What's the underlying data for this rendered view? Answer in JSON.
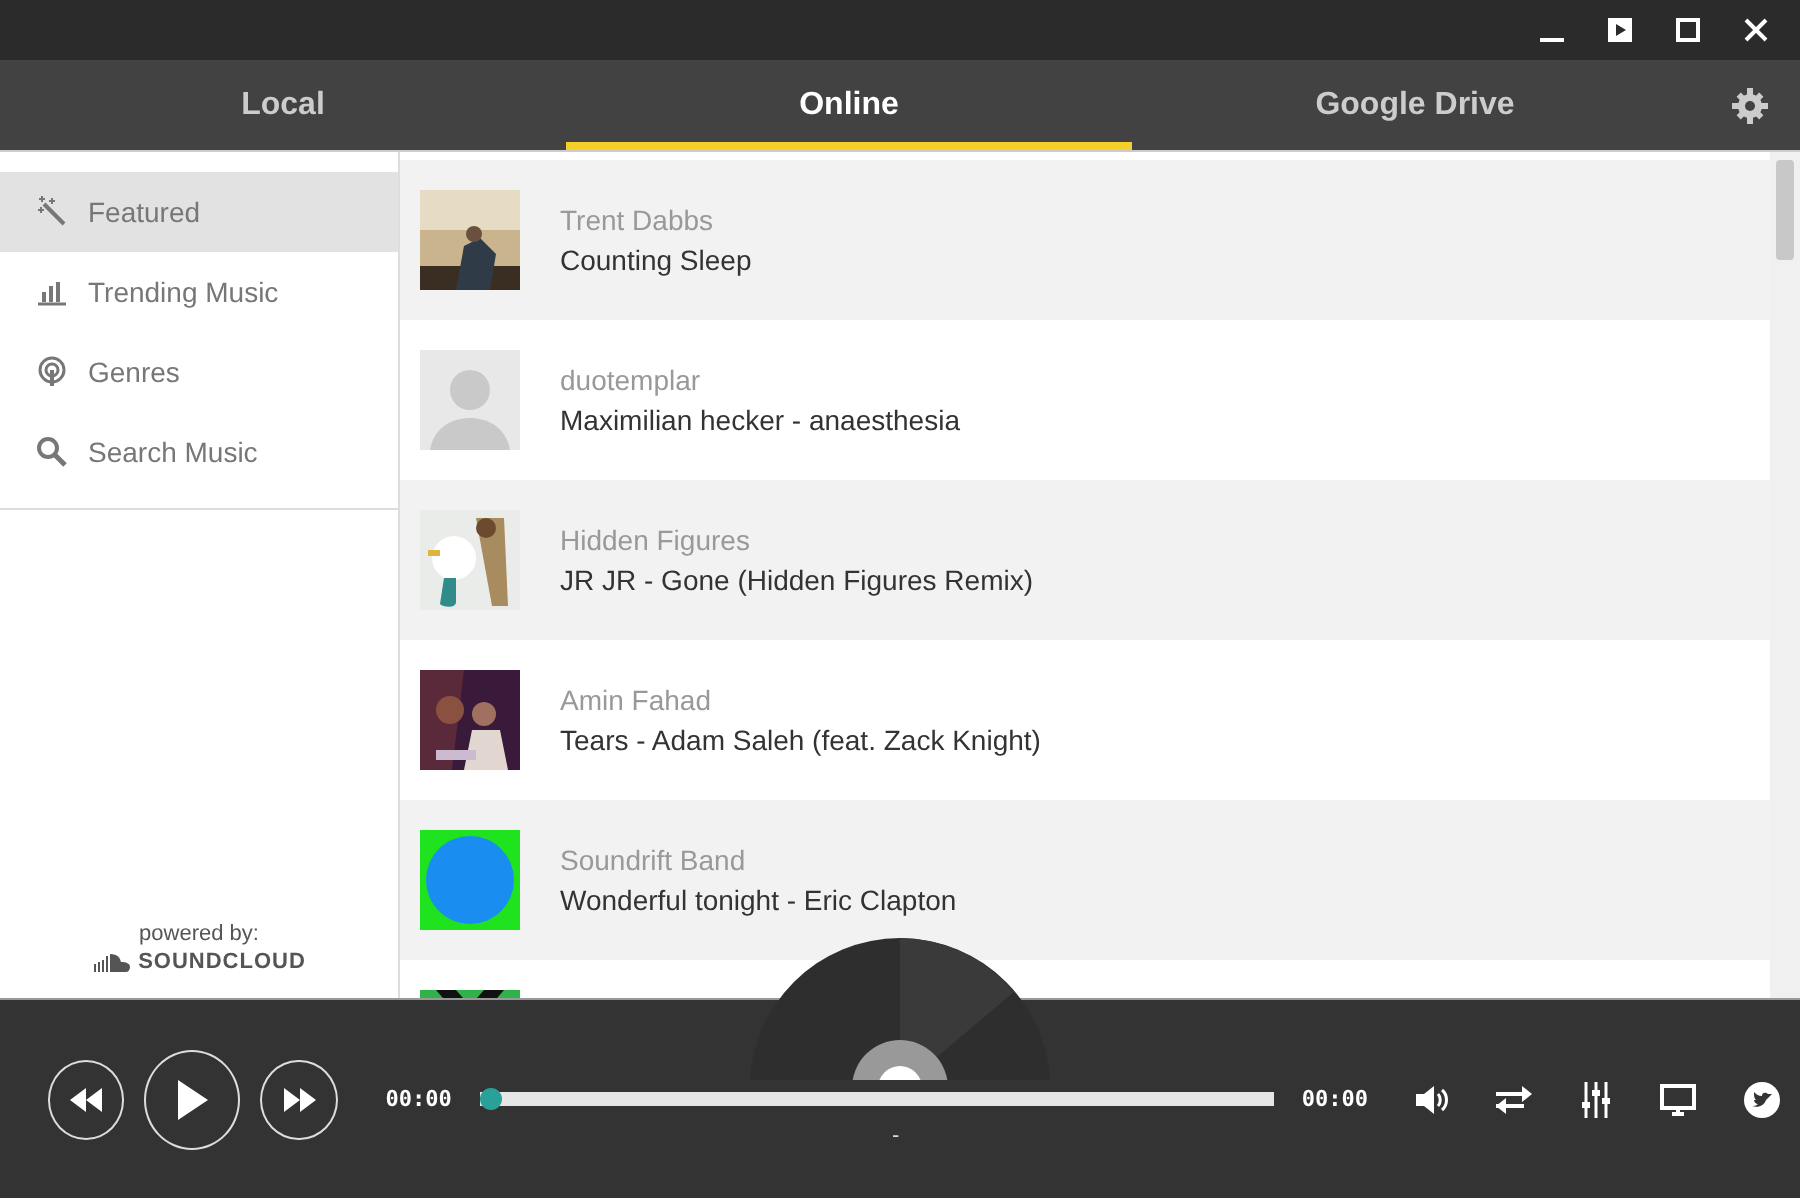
{
  "tabs": [
    {
      "label": "Local",
      "selected": false
    },
    {
      "label": "Online",
      "selected": true
    },
    {
      "label": "Google Drive",
      "selected": false
    }
  ],
  "sidebar": {
    "items": [
      {
        "label": "Featured",
        "selected": true
      },
      {
        "label": "Trending Music",
        "selected": false
      },
      {
        "label": "Genres",
        "selected": false
      },
      {
        "label": "Search Music",
        "selected": false
      }
    ],
    "powered_by": "powered by:",
    "brand": "SOUNDCLOUD"
  },
  "tracks": [
    {
      "kind": "track",
      "artist": "Trent Dabbs",
      "title": "Counting Sleep"
    },
    {
      "kind": "track",
      "artist": "duotemplar",
      "title": "Maximilian hecker - anaesthesia"
    },
    {
      "kind": "track",
      "artist": "Hidden Figures",
      "title": "JR JR - Gone (Hidden Figures Remix)"
    },
    {
      "kind": "track",
      "artist": "Amin Fahad",
      "title": "Tears - Adam Saleh (feat. Zack Knight)"
    },
    {
      "kind": "track",
      "artist": "Soundrift Band",
      "title": "Wonderful tonight - Eric Clapton"
    },
    {
      "kind": "picture"
    }
  ],
  "player": {
    "elapsed": "00:00",
    "duration": "00:00",
    "level": 0,
    "now_playing": "-"
  }
}
